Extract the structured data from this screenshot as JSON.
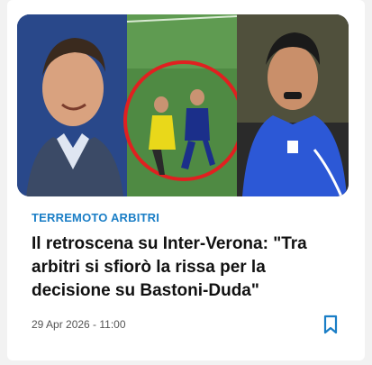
{
  "article": {
    "category": "TERREMOTO ARBITRI",
    "title": "Il retroscena su Inter-Verona: \"Tra arbitri si sfiorò la rissa per la decisione su Bastoni-Duda\"",
    "date": "29 Apr 2026 - 11:00",
    "bookmark_icon": "bookmark-icon",
    "accent_color": "#1a7ec6"
  }
}
